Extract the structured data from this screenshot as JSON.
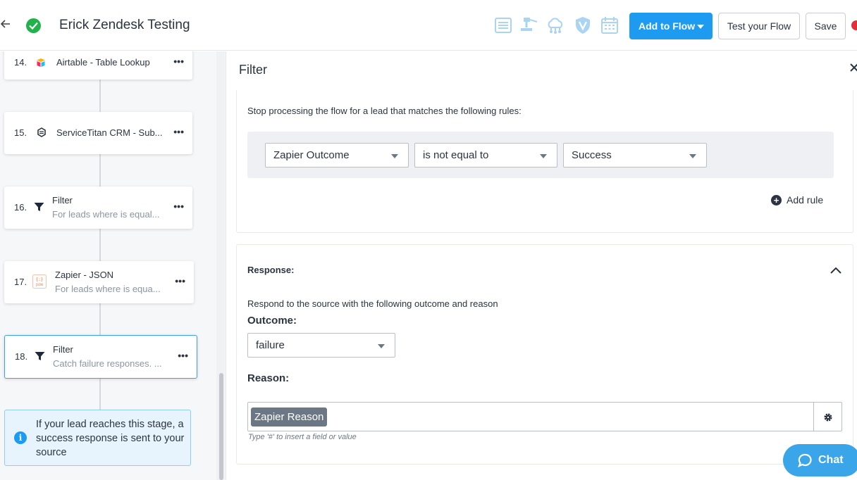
{
  "header": {
    "back_icon": "arrow-left-icon",
    "status_icon": "check-circle-icon",
    "title": "Erick Zendesk Testing",
    "toolbar_icons": [
      "list-icon",
      "gavel-icon",
      "cloud-network-icon",
      "shield-v-icon",
      "calendar-icon"
    ],
    "add_to_flow_label": "Add to Flow",
    "test_flow_label": "Test your Flow",
    "save_label": "Save",
    "accent_color": "#1d9bf0"
  },
  "sidebar": {
    "steps": [
      {
        "number": "14.",
        "icon": "airtable-icon",
        "title": "Airtable - Table Lookup",
        "subtitle": ""
      },
      {
        "number": "15.",
        "icon": "servicetitan-icon",
        "title": "ServiceTitan CRM - Sub...",
        "subtitle": ""
      },
      {
        "number": "16.",
        "icon": "filter-icon",
        "title": "Filter",
        "subtitle": "For leads where is equal..."
      },
      {
        "number": "17.",
        "icon": "json-icon",
        "title": "Zapier - JSON",
        "subtitle": "For leads where is equa..."
      },
      {
        "number": "18.",
        "icon": "filter-icon",
        "title": "Filter",
        "subtitle": "Catch failure responses. ..."
      }
    ],
    "more_label": "•••",
    "info_text": "If your lead reaches this stage, a success response is sent to your source"
  },
  "panel": {
    "title": "Filter",
    "close_icon": "close-icon",
    "filter_description": "Stop processing the flow for a lead that matches the following rules:",
    "rule": {
      "field": "Zapier Outcome",
      "operator": "is not equal to",
      "value": "Success"
    },
    "add_rule_label": "Add rule",
    "response": {
      "title": "Response:",
      "description": "Respond to the source with the following outcome and reason",
      "outcome_label": "Outcome:",
      "outcome_value": "failure",
      "reason_label": "Reason:",
      "reason_token": "Zapier Reason",
      "hint": "Type '#' to insert a field or value"
    }
  },
  "chat": {
    "label": "Chat",
    "color": "#3aa5e8"
  }
}
